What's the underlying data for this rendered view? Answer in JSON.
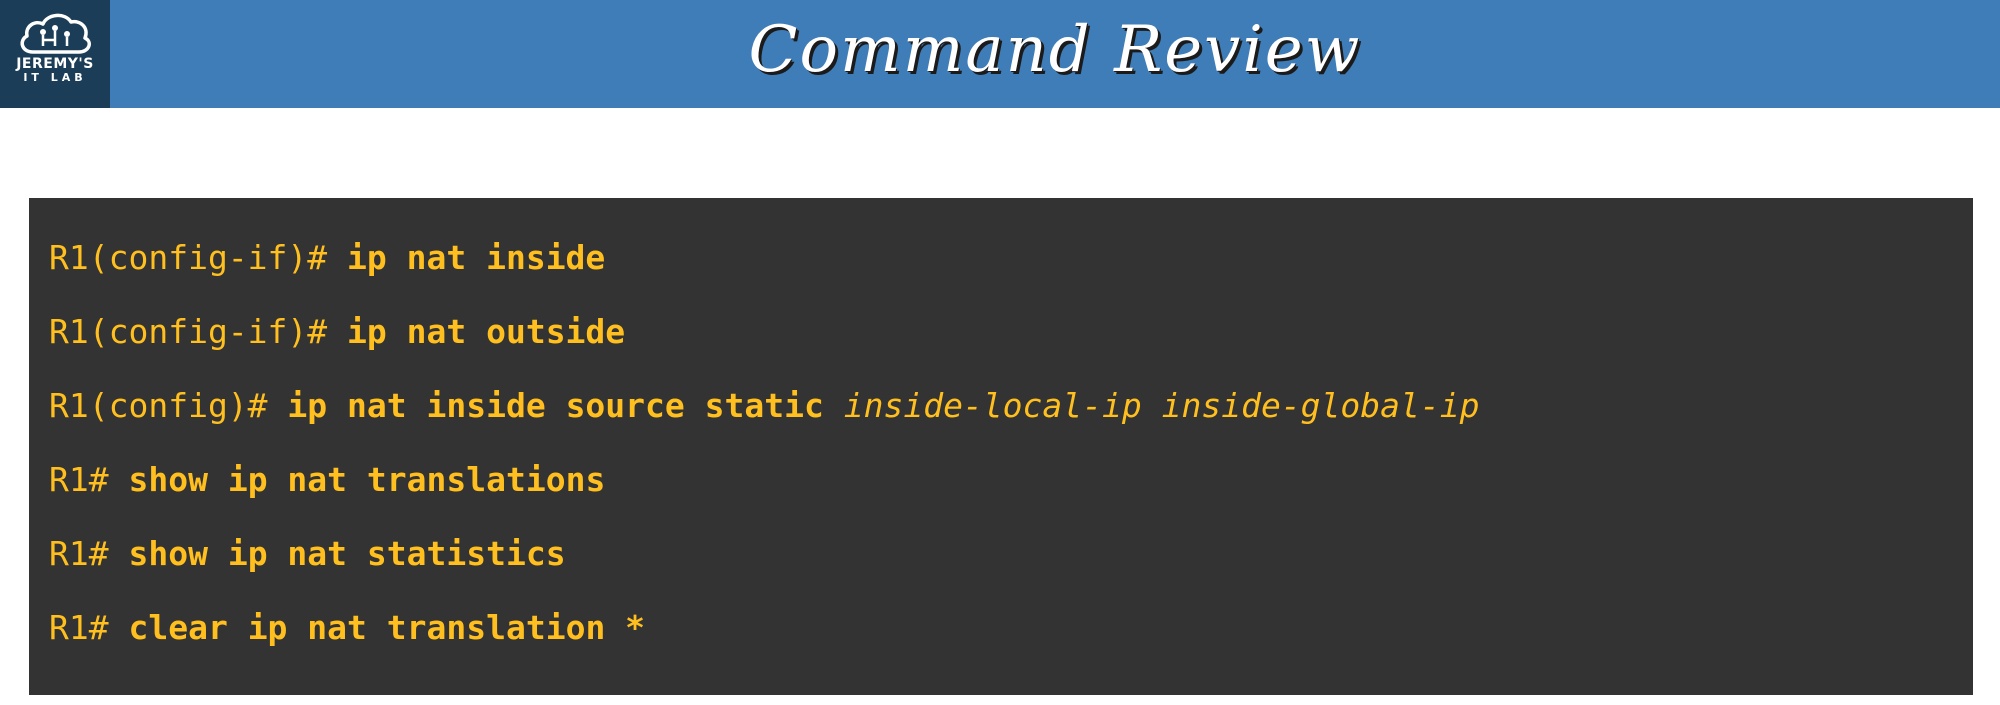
{
  "logo": {
    "line1": "JEREMY'S",
    "line2": "IT LAB"
  },
  "title": "Command Review",
  "colors": {
    "header": "#3f7db9",
    "logo_bg": "#1c3d57",
    "terminal_bg": "#333333",
    "command_text": "#ffbf1f"
  },
  "commands": [
    {
      "prompt": "R1(config-if)# ",
      "command": "ip nat inside",
      "args": ""
    },
    {
      "prompt": "R1(config-if)# ",
      "command": "ip nat outside",
      "args": ""
    },
    {
      "prompt": "R1(config)# ",
      "command": "ip nat inside source static",
      "args": " inside-local-ip inside-global-ip"
    },
    {
      "prompt": "R1# ",
      "command": "show ip nat translations",
      "args": ""
    },
    {
      "prompt": "R1# ",
      "command": "show ip nat statistics",
      "args": ""
    },
    {
      "prompt": "R1# ",
      "command": "clear ip nat translation *",
      "args": ""
    }
  ]
}
